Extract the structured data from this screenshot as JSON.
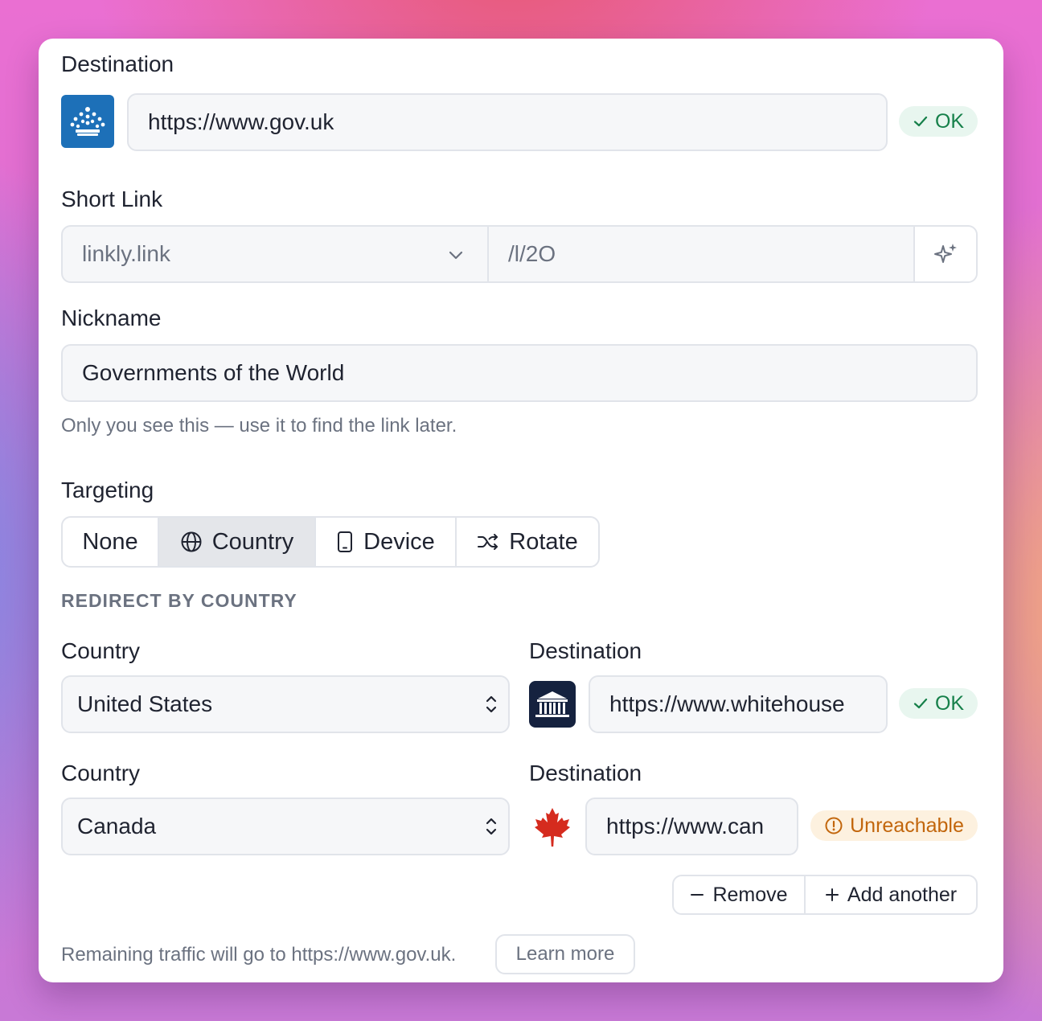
{
  "destination": {
    "label": "Destination",
    "url": "https://www.gov.uk",
    "status": "OK"
  },
  "short_link": {
    "label": "Short Link",
    "domain": "linkly.link",
    "slug": "/l/2O"
  },
  "nickname": {
    "label": "Nickname",
    "value": "Governments of the World",
    "hint": "Only you see this — use it to find the link later."
  },
  "targeting": {
    "label": "Targeting",
    "options": [
      "None",
      "Country",
      "Device",
      "Rotate"
    ],
    "selected": "Country"
  },
  "redirect": {
    "section_title": "REDIRECT BY COUNTRY",
    "rules": [
      {
        "country_label": "Country",
        "country": "United States",
        "destination_label": "Destination",
        "url": "https://www.whitehouse",
        "status": "OK"
      },
      {
        "country_label": "Country",
        "country": "Canada",
        "destination_label": "Destination",
        "url": "https://www.can",
        "status": "Unreachable"
      }
    ],
    "remove_label": "Remove",
    "add_label": "Add another"
  },
  "footer": {
    "text": "Remaining traffic will go to https://www.gov.uk.",
    "learn_more": "Learn more"
  },
  "colors": {
    "ok": "#16804a",
    "ok_bg": "#e8f6ef",
    "warn": "#c2660c",
    "warn_bg": "#fdf1df",
    "gov_uk_blue": "#1d70b8",
    "canada_red": "#d52b1e"
  },
  "icons": {
    "destination_favicon": "crown-icon",
    "short_link_generate": "sparkles-icon",
    "country_tab": "globe-icon",
    "device_tab": "phone-icon",
    "rotate_tab": "shuffle-icon",
    "us_favicon": "whitehouse-icon",
    "canada_favicon": "maple-leaf-icon",
    "ok_status": "check-icon",
    "unreachable_status": "alert-circle-icon"
  }
}
